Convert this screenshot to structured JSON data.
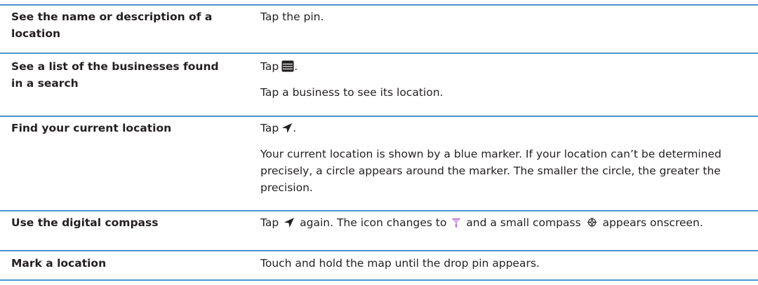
{
  "rows": [
    {
      "task": "See the name or description of a location",
      "action_lines": [
        "Tap the pin."
      ]
    },
    {
      "task": "See a list of the businesses found in a search",
      "action_prefix": "Tap",
      "action_icon": "list-icon",
      "action_suffix": ".",
      "action_lines": [
        "Tap a business to see its location."
      ]
    },
    {
      "task": "Find your current location",
      "action_prefix": "Tap",
      "action_icon": "location-arrow-icon",
      "action_suffix": ".",
      "action_lines": [
        "Your current location is shown by a blue marker. If your location can’t be determined precisely, a circle appears around the marker. The smaller the circle, the greater the precision."
      ]
    },
    {
      "task": "Use the digital compass",
      "action_parts": {
        "p1": "Tap",
        "p2": "again. The icon changes to",
        "p3": "and a small compass",
        "p4": "appears onscreen."
      },
      "icons": [
        "location-arrow-icon",
        "compass-beacon-icon",
        "compass-rose-icon"
      ]
    },
    {
      "task": "Mark a location",
      "action_lines": [
        "Touch and hold the map until the drop pin appears."
      ]
    }
  ],
  "colors": {
    "rule": "#4f95cf",
    "text": "#231f20",
    "beacon": "#b05bc7"
  }
}
